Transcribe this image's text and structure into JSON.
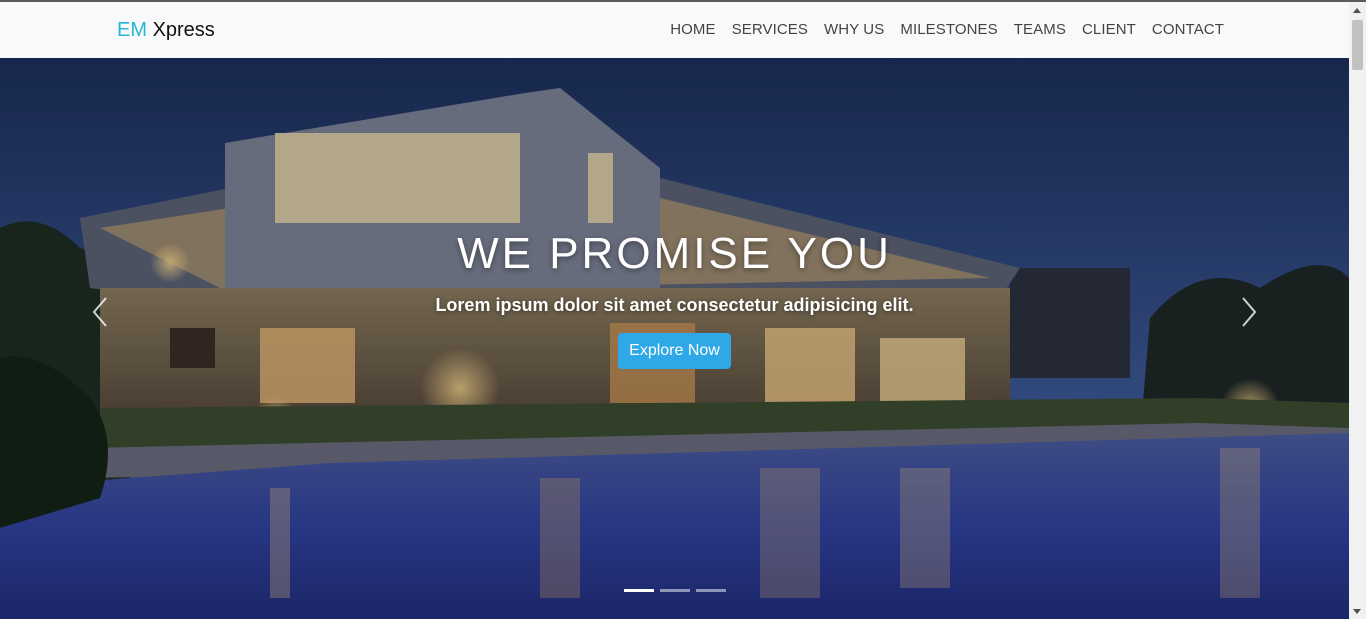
{
  "brand": {
    "prefix": "EM",
    "suffix": "Xpress"
  },
  "nav": {
    "items": [
      {
        "label": "HOME"
      },
      {
        "label": "SERVICES"
      },
      {
        "label": "WHY US"
      },
      {
        "label": "MILESTONES"
      },
      {
        "label": "TEAMS"
      },
      {
        "label": "CLIENT"
      },
      {
        "label": "CONTACT"
      }
    ]
  },
  "hero": {
    "headline": "WE PROMISE YOU",
    "subline": "Lorem ipsum dolor sit amet consectetur adipisicing elit.",
    "button_label": "Explore Now",
    "slide_count": 3,
    "active_slide": 1
  },
  "colors": {
    "brand_accent": "#29b6d6",
    "button": "#2ea8e6",
    "navbar_bg": "#f8f9fa"
  },
  "icons": {
    "prev": "chevron-left-icon",
    "next": "chevron-right-icon"
  }
}
